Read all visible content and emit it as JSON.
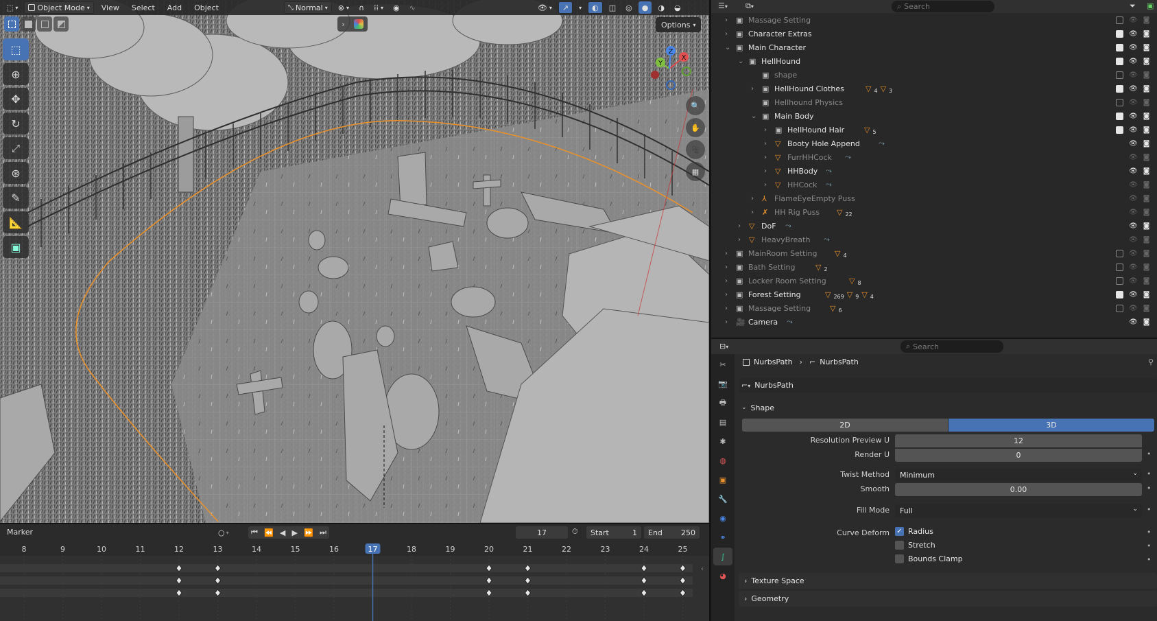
{
  "viewport": {
    "mode": "Object Mode",
    "menus": [
      "View",
      "Select",
      "Add",
      "Object"
    ],
    "orientation": "Normal",
    "options_label": "Options",
    "gizmo_axes": {
      "x": "X",
      "y": "Y",
      "z": "Z"
    }
  },
  "timeline": {
    "marker_label": "Marker",
    "current_frame": "17",
    "start_label": "Start",
    "start_value": "1",
    "end_label": "End",
    "end_value": "250",
    "ticks": [
      "8",
      "9",
      "10",
      "11",
      "12",
      "13",
      "14",
      "15",
      "16",
      "17",
      "18",
      "19",
      "20",
      "21",
      "22",
      "23",
      "24",
      "25"
    ],
    "playhead": "17"
  },
  "outliner": {
    "search_placeholder": "Search",
    "rows": [
      {
        "label": "Massage Setting",
        "depth": 1,
        "icon": "collection",
        "dim": true,
        "extra": ""
      },
      {
        "label": "Character Extras",
        "depth": 1,
        "icon": "collection",
        "dim": false,
        "extra": ""
      },
      {
        "label": "Main Character",
        "depth": 1,
        "icon": "collection",
        "dim": false,
        "extra": ""
      },
      {
        "label": "HellHound",
        "depth": 2,
        "icon": "collection",
        "dim": false,
        "extra": ""
      },
      {
        "label": "shape",
        "depth": 3,
        "icon": "collection",
        "dim": true,
        "extra": ""
      },
      {
        "label": "HellHound Clothes",
        "depth": 3,
        "icon": "collection",
        "dim": false,
        "extra": "4",
        "extra2": "3"
      },
      {
        "label": "Hellhound Physics",
        "depth": 3,
        "icon": "collection",
        "dim": true,
        "extra": ""
      },
      {
        "label": "Main Body",
        "depth": 3,
        "icon": "collection",
        "dim": false,
        "extra": ""
      },
      {
        "label": "HellHound Hair",
        "depth": 4,
        "icon": "collection",
        "dim": false,
        "extra": "5"
      },
      {
        "label": "Booty Hole Append",
        "depth": 4,
        "icon": "mesh",
        "dim": false,
        "extra": ""
      },
      {
        "label": "FurrHHCock",
        "depth": 4,
        "icon": "mesh",
        "dim": true,
        "extra": ""
      },
      {
        "label": "HHBody",
        "depth": 4,
        "icon": "mesh",
        "dim": false,
        "extra": ""
      },
      {
        "label": "HHCock",
        "depth": 4,
        "icon": "mesh",
        "dim": true,
        "extra": ""
      },
      {
        "label": "FlameEyeEmpty Puss",
        "depth": 3,
        "icon": "empty",
        "dim": true,
        "extra": ""
      },
      {
        "label": "HH Rig Puss",
        "depth": 3,
        "icon": "armature",
        "dim": true,
        "extra": "22"
      },
      {
        "label": "DoF",
        "depth": 2,
        "icon": "mesh",
        "dim": false,
        "extra": ""
      },
      {
        "label": "HeavyBreath",
        "depth": 2,
        "icon": "mesh",
        "dim": true,
        "extra": ""
      },
      {
        "label": "MainRoom Setting",
        "depth": 1,
        "icon": "collection",
        "dim": true,
        "extra": "4"
      },
      {
        "label": "Bath Setting",
        "depth": 1,
        "icon": "collection",
        "dim": true,
        "extra": "2"
      },
      {
        "label": "Locker Room Setting",
        "depth": 1,
        "icon": "collection",
        "dim": true,
        "extra": "8"
      },
      {
        "label": "Forest Setting",
        "depth": 1,
        "icon": "collection",
        "dim": false,
        "extra": "269",
        "extra2": "9",
        "extra3": "4"
      },
      {
        "label": "Massage Setting",
        "depth": 1,
        "icon": "collection",
        "dim": true,
        "extra": "6"
      },
      {
        "label": "Camera",
        "depth": 1,
        "icon": "camera",
        "dim": false,
        "extra": ""
      }
    ]
  },
  "properties": {
    "search_placeholder": "Search",
    "breadcrumb": [
      "NurbsPath",
      "NurbsPath"
    ],
    "datablock": "NurbsPath",
    "shape_panel": "Shape",
    "dim_2d": "2D",
    "dim_3d": "3D",
    "res_preview_label": "Resolution Preview U",
    "res_preview_value": "12",
    "render_u_label": "Render U",
    "render_u_value": "0",
    "twist_label": "Twist Method",
    "twist_value": "Minimum",
    "smooth_label": "Smooth",
    "smooth_value": "0.00",
    "fill_label": "Fill Mode",
    "fill_value": "Full",
    "curve_deform_label": "Curve Deform",
    "radius_label": "Radius",
    "stretch_label": "Stretch",
    "bounds_label": "Bounds Clamp",
    "texture_space_label": "Texture Space",
    "geometry_label": "Geometry"
  },
  "colors": {
    "accent": "#4772b3",
    "curve": "#e8912d",
    "mesh_icon": "#e8912d"
  }
}
